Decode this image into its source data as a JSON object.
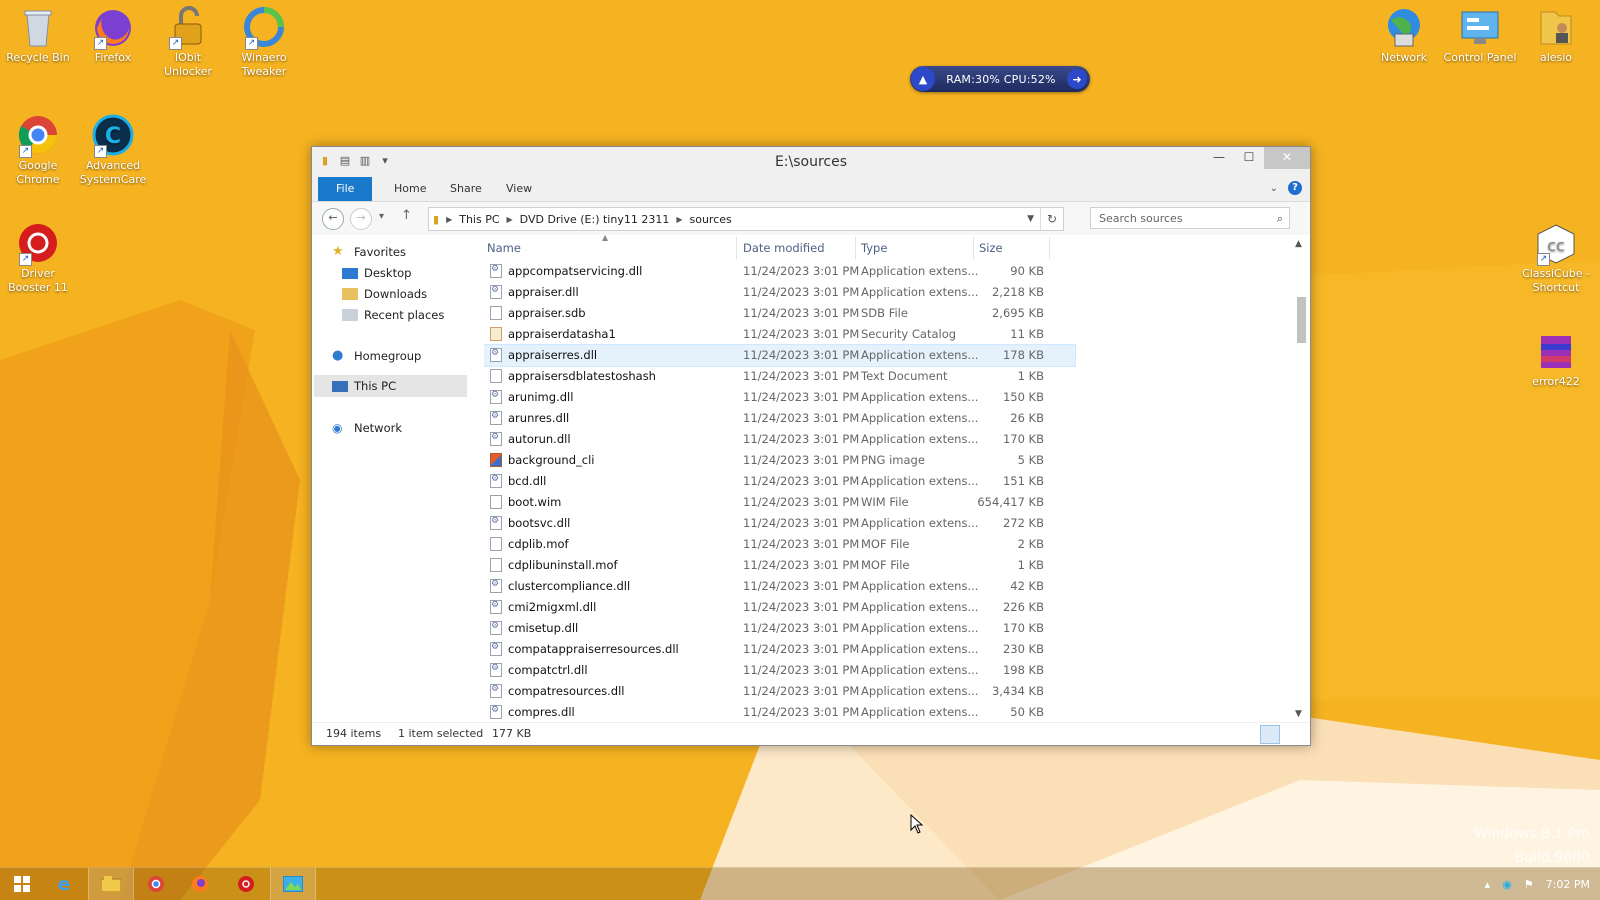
{
  "desktop": {
    "icons_left": [
      {
        "label_line1": "Recycle Bin",
        "label_line2": ""
      },
      {
        "label_line1": "Firefox",
        "label_line2": ""
      },
      {
        "label_line1": "IObit",
        "label_line2": "Unlocker"
      },
      {
        "label_line1": "Winaero",
        "label_line2": "Tweaker"
      },
      {
        "label_line1": "Google",
        "label_line2": "Chrome"
      },
      {
        "label_line1": "Advanced",
        "label_line2": "SystemCare"
      },
      {
        "label_line1": "Driver",
        "label_line2": "Booster 11"
      }
    ],
    "icons_right": [
      {
        "label_line1": "Network",
        "label_line2": ""
      },
      {
        "label_line1": "Control Panel",
        "label_line2": ""
      },
      {
        "label_line1": "alesio",
        "label_line2": ""
      },
      {
        "label_line1": "ClassiCube -",
        "label_line2": "Shortcut"
      },
      {
        "label_line1": "error422",
        "label_line2": ""
      }
    ],
    "watermark_line1": "Windows 8.1 Pro",
    "watermark_line2": "Build 9600"
  },
  "sysmon": {
    "text": "RAM:30%   CPU:52%"
  },
  "window": {
    "title": "E:\\sources",
    "ribbon_tabs": [
      "File",
      "Home",
      "Share",
      "View"
    ],
    "address": {
      "segments": [
        "This PC",
        "DVD Drive (E:) tiny11 2311",
        "sources"
      ]
    },
    "search_placeholder": "Search sources",
    "nav": {
      "favorites": "Favorites",
      "desktop": "Desktop",
      "downloads": "Downloads",
      "recent": "Recent places",
      "homegroup": "Homegroup",
      "thispc": "This PC",
      "network": "Network"
    },
    "columns": {
      "name": "Name",
      "date": "Date modified",
      "type": "Type",
      "size": "Size"
    },
    "files": [
      {
        "name": "appcompatservicing.dll",
        "date": "11/24/2023 3:01 PM",
        "type": "Application extens...",
        "size": "90 KB",
        "icon": "dll"
      },
      {
        "name": "appraiser.dll",
        "date": "11/24/2023 3:01 PM",
        "type": "Application extens...",
        "size": "2,218 KB",
        "icon": "dll"
      },
      {
        "name": "appraiser.sdb",
        "date": "11/24/2023 3:01 PM",
        "type": "SDB File",
        "size": "2,695 KB",
        "icon": "file"
      },
      {
        "name": "appraiserdatasha1",
        "date": "11/24/2023 3:01 PM",
        "type": "Security Catalog",
        "size": "11 KB",
        "icon": "cat"
      },
      {
        "name": "appraiserres.dll",
        "date": "11/24/2023 3:01 PM",
        "type": "Application extens...",
        "size": "178 KB",
        "icon": "dll"
      },
      {
        "name": "appraisersdblatestoshash",
        "date": "11/24/2023 3:01 PM",
        "type": "Text Document",
        "size": "1 KB",
        "icon": "file"
      },
      {
        "name": "arunimg.dll",
        "date": "11/24/2023 3:01 PM",
        "type": "Application extens...",
        "size": "150 KB",
        "icon": "dll"
      },
      {
        "name": "arunres.dll",
        "date": "11/24/2023 3:01 PM",
        "type": "Application extens...",
        "size": "26 KB",
        "icon": "dll"
      },
      {
        "name": "autorun.dll",
        "date": "11/24/2023 3:01 PM",
        "type": "Application extens...",
        "size": "170 KB",
        "icon": "dll"
      },
      {
        "name": "background_cli",
        "date": "11/24/2023 3:01 PM",
        "type": "PNG image",
        "size": "5 KB",
        "icon": "png"
      },
      {
        "name": "bcd.dll",
        "date": "11/24/2023 3:01 PM",
        "type": "Application extens...",
        "size": "151 KB",
        "icon": "dll"
      },
      {
        "name": "boot.wim",
        "date": "11/24/2023 3:01 PM",
        "type": "WIM File",
        "size": "654,417 KB",
        "icon": "file"
      },
      {
        "name": "bootsvc.dll",
        "date": "11/24/2023 3:01 PM",
        "type": "Application extens...",
        "size": "272 KB",
        "icon": "dll"
      },
      {
        "name": "cdplib.mof",
        "date": "11/24/2023 3:01 PM",
        "type": "MOF File",
        "size": "2 KB",
        "icon": "file"
      },
      {
        "name": "cdplibuninstall.mof",
        "date": "11/24/2023 3:01 PM",
        "type": "MOF File",
        "size": "1 KB",
        "icon": "file"
      },
      {
        "name": "clustercompliance.dll",
        "date": "11/24/2023 3:01 PM",
        "type": "Application extens...",
        "size": "42 KB",
        "icon": "dll"
      },
      {
        "name": "cmi2migxml.dll",
        "date": "11/24/2023 3:01 PM",
        "type": "Application extens...",
        "size": "226 KB",
        "icon": "dll"
      },
      {
        "name": "cmisetup.dll",
        "date": "11/24/2023 3:01 PM",
        "type": "Application extens...",
        "size": "170 KB",
        "icon": "dll"
      },
      {
        "name": "compatappraiserresources.dll",
        "date": "11/24/2023 3:01 PM",
        "type": "Application extens...",
        "size": "230 KB",
        "icon": "dll"
      },
      {
        "name": "compatctrl.dll",
        "date": "11/24/2023 3:01 PM",
        "type": "Application extens...",
        "size": "198 KB",
        "icon": "dll"
      },
      {
        "name": "compatresources.dll",
        "date": "11/24/2023 3:01 PM",
        "type": "Application extens...",
        "size": "3,434 KB",
        "icon": "dll"
      },
      {
        "name": "compres.dll",
        "date": "11/24/2023 3:01 PM",
        "type": "Application extens...",
        "size": "50 KB",
        "icon": "dll"
      }
    ],
    "selected_index": 4,
    "status": {
      "count": "194 items",
      "selection": "1 item selected",
      "selection_size": "177 KB"
    }
  },
  "taskbar": {
    "clock": "7:02 PM"
  },
  "colors": {
    "desktop_bg": "#f6b321",
    "file_tab": "#1979ca",
    "selection": "#e5f1fb"
  }
}
